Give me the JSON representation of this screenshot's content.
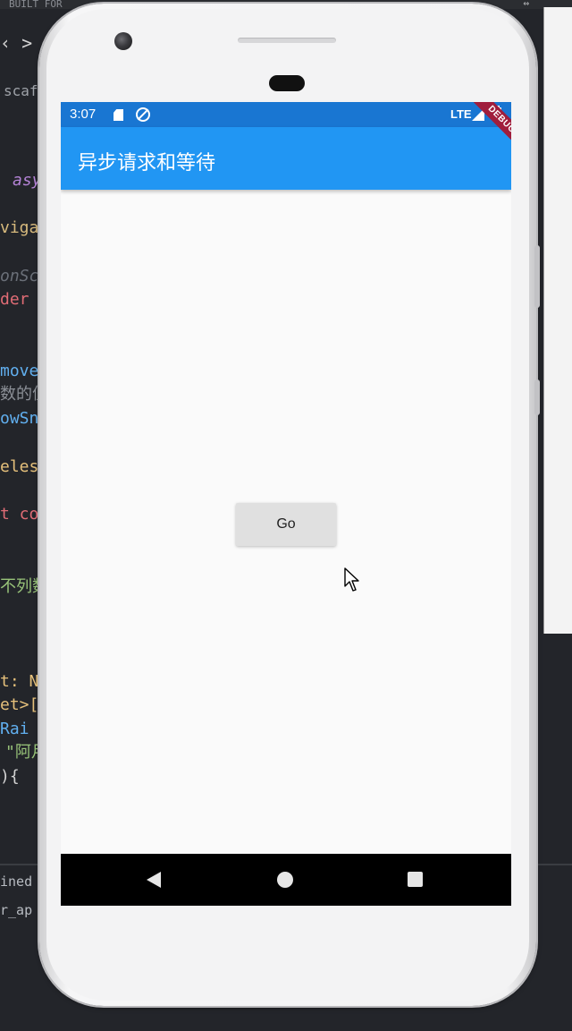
{
  "editor": {
    "top_strip_text": "BUILT FOR",
    "top_strip_icon": "⇔",
    "lines": {
      "nav": "‹ >",
      "scaf": "scaf",
      "asy": "asy",
      "vigat": "vigat",
      "onsc": "onScr",
      "der": "der",
      "move": "move(",
      "zh1": "数的值",
      "owsna": "owSna",
      "eles": "eles",
      "tco": "t co",
      "zh2": "不列数",
      "tn": "t: N",
      "et": "et>[",
      "rai": "Rai",
      "zh3": "\"阿月",
      "brace": "){",
      "ined": "ined",
      "rap": "r_ap"
    }
  },
  "phone": {
    "status_bar": {
      "time": "3:07",
      "network": "LTE",
      "color": "#1976d2"
    },
    "app_bar": {
      "title": "异步请求和等待",
      "color": "#2196f3"
    },
    "debug_banner": "DEBUG",
    "body": {
      "go_button_label": "Go"
    },
    "nav_bar": {
      "icons": [
        "back-icon",
        "home-icon",
        "recent-apps-icon"
      ]
    }
  }
}
